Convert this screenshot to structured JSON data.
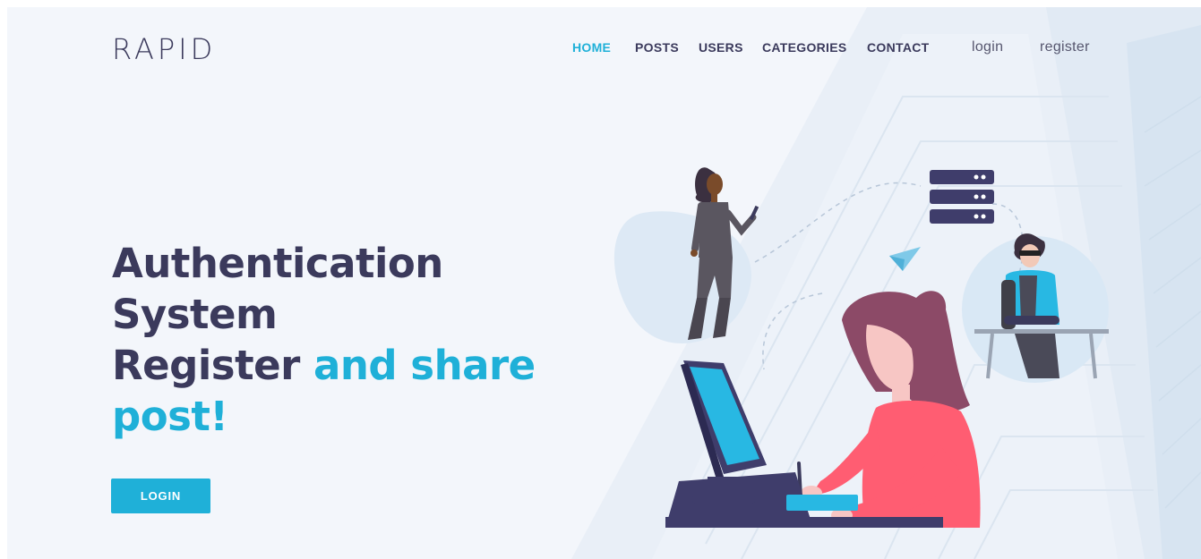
{
  "brand": {
    "logo": "RAPID"
  },
  "nav": {
    "items": [
      {
        "label": "HOME",
        "active": true
      },
      {
        "label": "POSTS",
        "active": false
      },
      {
        "label": "USERS",
        "active": false
      },
      {
        "label": "CATEGORIES",
        "active": false
      },
      {
        "label": "CONTACT",
        "active": false
      }
    ],
    "login": "login",
    "register": "register"
  },
  "hero": {
    "line1": "Authentication",
    "line2": "System",
    "line3_dark": "Register",
    "line3_accent": "and share",
    "line4_accent": "post!",
    "cta_label": "LOGIN"
  },
  "colors": {
    "accent": "#1fb0d8",
    "text_dark": "#3b3a5c",
    "background": "#f3f6fb"
  }
}
